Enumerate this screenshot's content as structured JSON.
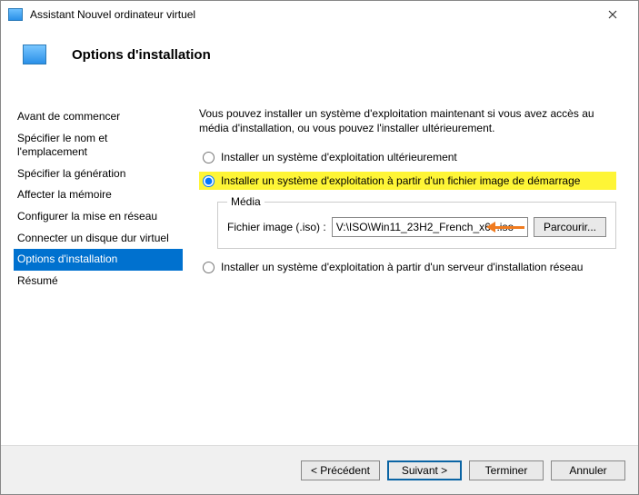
{
  "window": {
    "title": "Assistant Nouvel ordinateur virtuel"
  },
  "header": {
    "title": "Options d'installation"
  },
  "sidebar": {
    "steps": [
      "Avant de commencer",
      "Spécifier le nom et l'emplacement",
      "Spécifier la génération",
      "Affecter la mémoire",
      "Configurer la mise en réseau",
      "Connecter un disque dur virtuel",
      "Options d'installation",
      "Résumé"
    ],
    "active_index": 6
  },
  "main": {
    "intro": "Vous pouvez installer un système d'exploitation maintenant si vous avez accès au média d'installation, ou vous pouvez l'installer ultérieurement.",
    "opt_later": "Installer un système d'exploitation ultérieurement",
    "opt_image": "Installer un système d'exploitation à partir d'un fichier image de démarrage",
    "opt_network": "Installer un système d'exploitation à partir d'un serveur d'installation réseau",
    "media_legend": "Média",
    "iso_label": "Fichier image (.iso) :",
    "iso_value": "V:\\ISO\\Win11_23H2_French_x64.iso",
    "browse": "Parcourir...",
    "selected": "opt_image"
  },
  "footer": {
    "prev": "< Précédent",
    "next": "Suivant >",
    "finish": "Terminer",
    "cancel": "Annuler"
  }
}
